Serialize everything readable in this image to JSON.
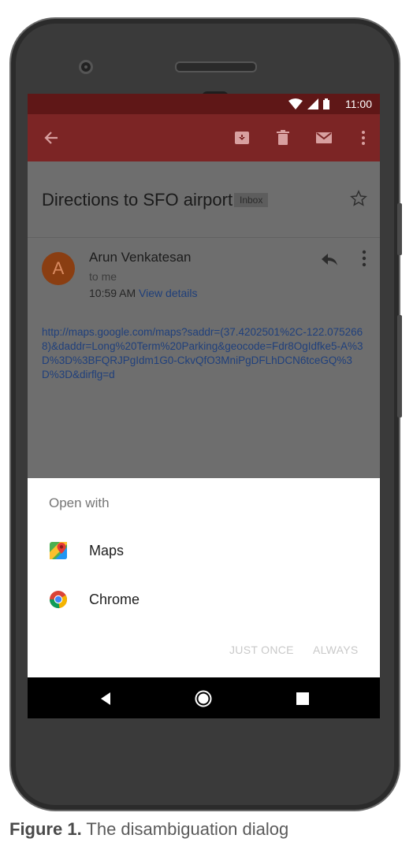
{
  "status_bar": {
    "time": "11:00"
  },
  "email": {
    "subject": "Directions to SFO airport",
    "label": "Inbox",
    "avatar_letter": "A",
    "sender": "Arun Venkatesan",
    "recipient": "to me",
    "time": "10:59 AM",
    "details_link": "View details",
    "body_link": "http://maps.google.com/maps?saddr=(37.4202501%2C-122.0752668)&daddr=Long%20Term%20Parking&geocode=Fdr8OgIdfke5-A%3D%3D%3BFQRJPgIdm1G0-CkvQfO3MniPgDFLhDCN6tceGQ%3D%3D&dirflg=d"
  },
  "dialog": {
    "title": "Open with",
    "apps": [
      {
        "label": "Maps",
        "icon": "maps-icon"
      },
      {
        "label": "Chrome",
        "icon": "chrome-icon"
      }
    ],
    "just_once": "JUST ONCE",
    "always": "ALWAYS"
  },
  "caption": {
    "label": "Figure 1.",
    "text": " The disambiguation dialog"
  }
}
